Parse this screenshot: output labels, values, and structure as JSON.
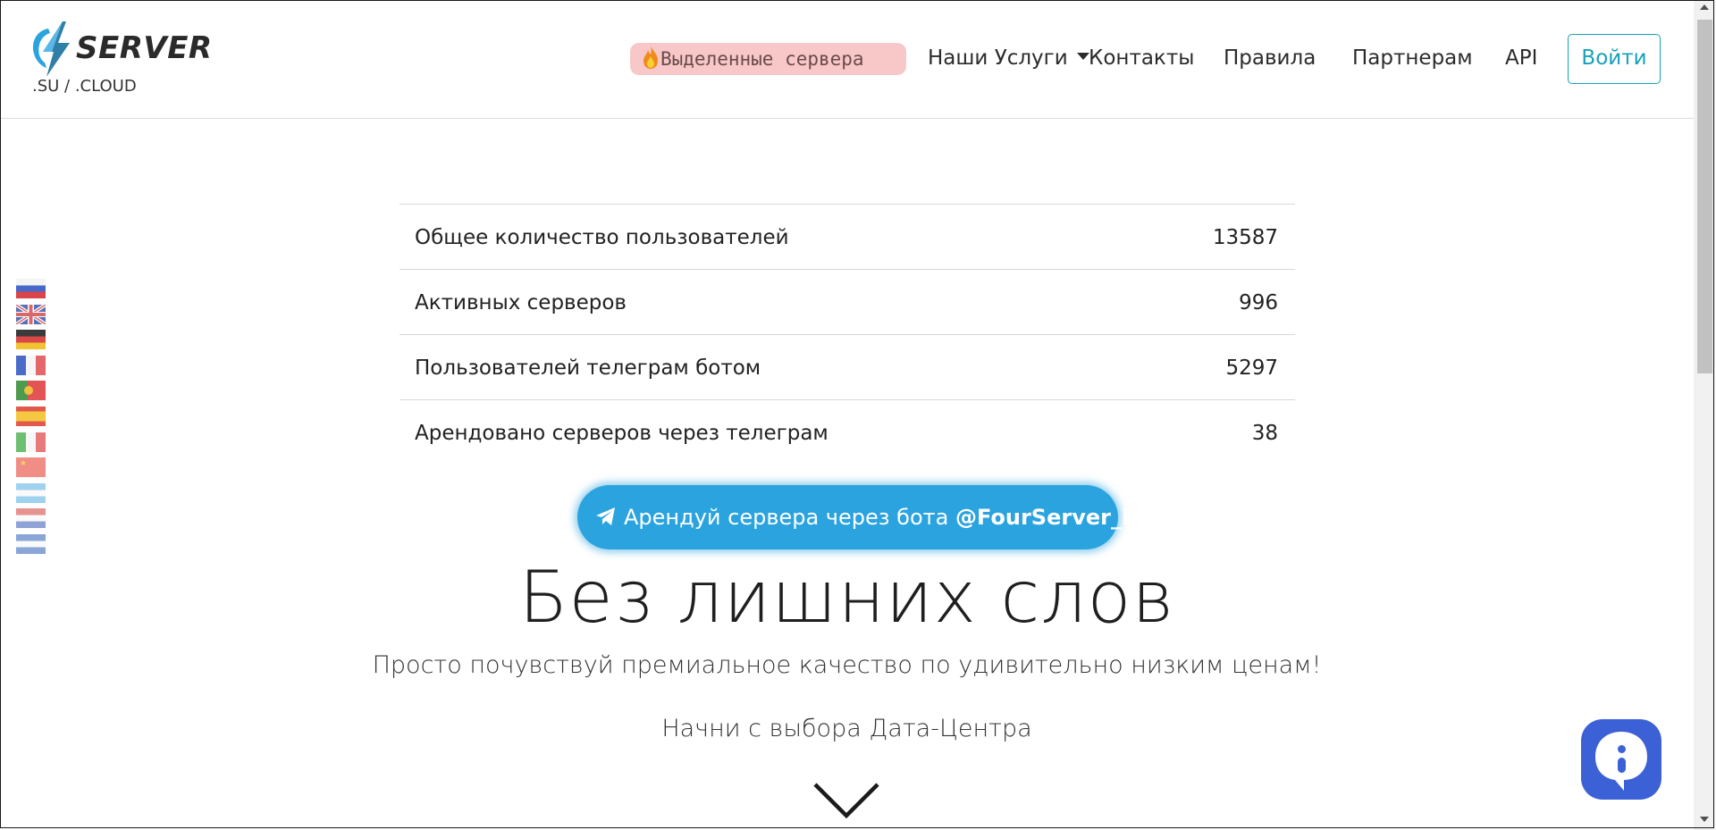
{
  "brand": {
    "name": "SERVER",
    "sub": ".SU / .CLOUD"
  },
  "nav": {
    "promo": "Выделенные сервера",
    "services": "Наши Услуги",
    "contacts": "Контакты",
    "rules": "Правила",
    "partners": "Партнерам",
    "api": "API",
    "login": "Войти"
  },
  "flags": [
    "ru",
    "gb",
    "de",
    "fr",
    "pt",
    "es",
    "it",
    "cn",
    "ar",
    "nl",
    "sv"
  ],
  "stats": [
    {
      "label": "Общее количество пользователей",
      "value": "13587"
    },
    {
      "label": "Активных серверов",
      "value": "996"
    },
    {
      "label": "Пользователей телеграм ботом",
      "value": "5297"
    },
    {
      "label": "Арендовано серверов через телеграм",
      "value": "38"
    }
  ],
  "telegram": {
    "text": "Арендуй сервера через бота",
    "bot": "@FourServer_bot"
  },
  "hero": {
    "title": "Без лишних слов",
    "subtitle": "Просто почувствуй премиальное качество по удивительно низким ценам!",
    "cta": "Начни с выбора Дата-Центра"
  },
  "colors": {
    "accent": "#17a2b8",
    "telegram": "#2aa3df",
    "chat": "#3c61d6",
    "promo_bg": "#f8c8c8"
  }
}
